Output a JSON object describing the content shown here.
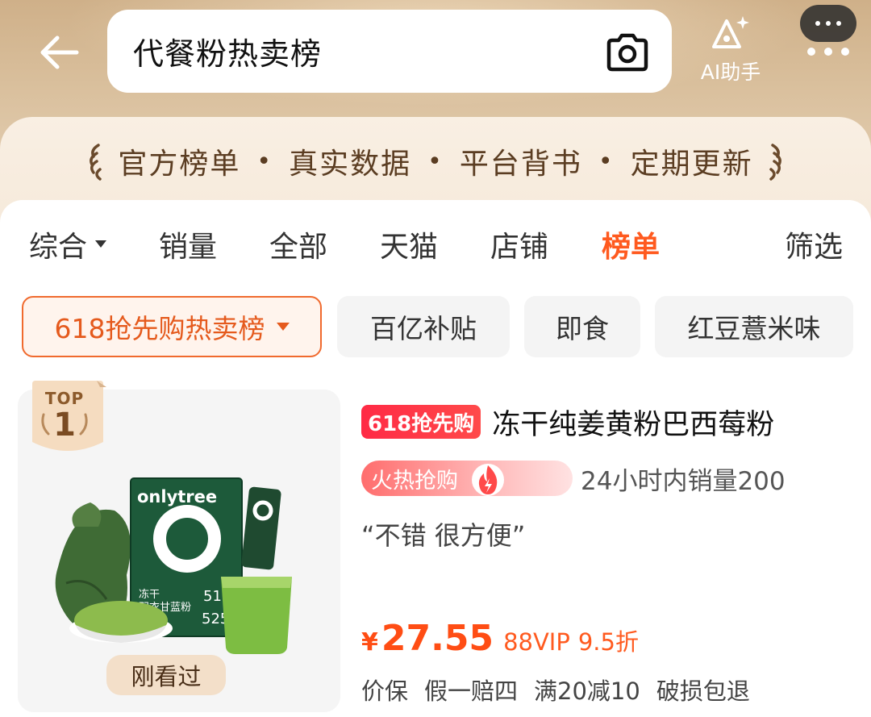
{
  "header": {
    "search_query": "代餐粉热卖榜",
    "ai_label": "AI助手"
  },
  "tagline": {
    "items": [
      "官方榜单",
      "真实数据",
      "平台背书",
      "定期更新"
    ]
  },
  "sort_tabs": [
    {
      "label": "综合",
      "active": false
    },
    {
      "label": "销量",
      "active": false
    },
    {
      "label": "全部",
      "active": false
    },
    {
      "label": "天猫",
      "active": false
    },
    {
      "label": "店铺",
      "active": false
    },
    {
      "label": "榜单",
      "active": true
    },
    {
      "label": "筛选",
      "active": false
    }
  ],
  "chips": [
    {
      "label": "618抢先购热卖榜",
      "selected": true
    },
    {
      "label": "百亿补贴",
      "selected": false
    },
    {
      "label": "即食",
      "selected": false
    },
    {
      "label": "红豆薏米味",
      "selected": false
    }
  ],
  "product": {
    "rank_label": "TOP",
    "rank": "1",
    "seen_label": "刚看过",
    "promo_tag": "618抢先购",
    "title": "冻干纯姜黄粉巴西莓粉",
    "hot_label": "火热抢购",
    "sales": "24小时内销量200",
    "review": "“不错 很方便”",
    "price_currency": "¥",
    "price": "27.55",
    "vip_label": "88VIP",
    "vip_discount": "9.5折",
    "services": [
      "价保",
      "假一赔四",
      "满20减10",
      "破损包退"
    ],
    "package_brand": "onlytree",
    "package_text": "冻干 羽衣甘蓝粉"
  },
  "colors": {
    "accent": "#ff5a1f",
    "price": "#ff4d14",
    "promo": "#ff2a45",
    "header_gold": "#cfb089"
  }
}
